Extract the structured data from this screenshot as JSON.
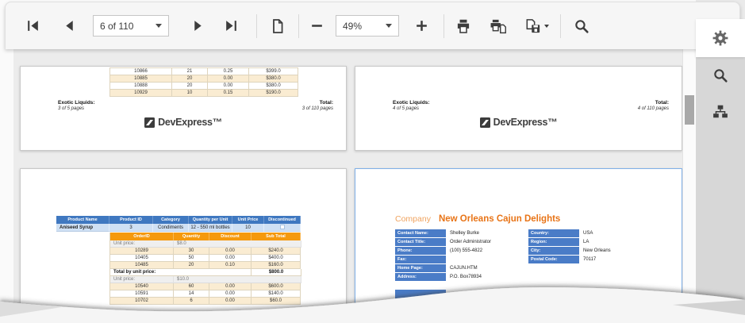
{
  "toolbar": {
    "page_value": "6 of 110",
    "zoom_value": "49%"
  },
  "icons": {
    "first_page": "|◀",
    "previous_page": "◀",
    "next_page": "▶",
    "last_page": "▶|",
    "single_page_view": "🗋",
    "zoom_out": "−",
    "zoom_in": "+",
    "print": "🖶",
    "print_page": "🖶🗋",
    "export": "💾▾",
    "search": "🔍",
    "collapse_panel": "‹",
    "settings_gear": "⚙",
    "search_panel": "🔍",
    "document_map": "🗺"
  },
  "colors": {
    "header_blue": "#3f78c0",
    "row_blue": "#cfe0f4",
    "accent_orange": "#f5990d",
    "row_tan": "#faecd2",
    "company_orange": "#e87417",
    "selected_page_border": "#7fb0e8"
  },
  "document": {
    "logo_text": "DevExpress™"
  },
  "pages": {
    "top_left": {
      "orders": [
        {
          "id": "10866",
          "qty": "21",
          "discount": "0.25",
          "subtotal": "$399.0"
        },
        {
          "id": "10885",
          "qty": "20",
          "discount": "0.00",
          "subtotal": "$380.0"
        },
        {
          "id": "10888",
          "qty": "20",
          "discount": "0.00",
          "subtotal": "$380.0"
        },
        {
          "id": "10929",
          "qty": "10",
          "discount": "0.15",
          "subtotal": "$190.0"
        }
      ],
      "footer": {
        "group": "Exotic Liquids:",
        "group_pages": "3 of 5 pages",
        "total_label": "Total:",
        "total_pages": "3 of 110 pages"
      }
    },
    "top_right": {
      "footer": {
        "group": "Exotic Liquids:",
        "group_pages": "4 of 5 pages",
        "total_label": "Total:",
        "total_pages": "4 of 110 pages"
      }
    },
    "bottom_left": {
      "product_header": [
        "Product Name",
        "Product ID",
        "Category",
        "Quantity per Unit",
        "Unit Price",
        "Discontinued"
      ],
      "product": {
        "name": "Aniseed Syrup",
        "id": "3",
        "category": "Condiments",
        "qty_per_unit": "12 - 550 ml bottles",
        "unit_price": "10"
      },
      "order_header": [
        "OrderID",
        "Quantity",
        "Discount",
        "Sub Total"
      ],
      "sections": [
        {
          "unit_price_label": "Unit price:",
          "unit_price": "$8.0",
          "rows": [
            {
              "id": "10289",
              "qty": "30",
              "discount": "0.00",
              "subtotal": "$240.0"
            },
            {
              "id": "10405",
              "qty": "50",
              "discount": "0.00",
              "subtotal": "$400.0"
            },
            {
              "id": "10485",
              "qty": "20",
              "discount": "0.10",
              "subtotal": "$160.0"
            }
          ],
          "total_label": "Total by unit price:",
          "total": "$800.0"
        },
        {
          "unit_price_label": "Unit price:",
          "unit_price": "$10.0",
          "rows": [
            {
              "id": "10540",
              "qty": "60",
              "discount": "0.00",
              "subtotal": "$600.0"
            },
            {
              "id": "10591",
              "qty": "14",
              "discount": "0.00",
              "subtotal": "$140.0"
            },
            {
              "id": "10702",
              "qty": "6",
              "discount": "0.00",
              "subtotal": "$60.0"
            }
          ]
        }
      ]
    },
    "bottom_right": {
      "company_label": "Company",
      "company_name": "New Orleans Cajun Delights",
      "left_fields": [
        {
          "label": "Contact Name:",
          "value": "Shelley Burke"
        },
        {
          "label": "Contact Title:",
          "value": "Order Administrator"
        },
        {
          "label": "Phone:",
          "value": "(100) 555-4822"
        },
        {
          "label": "Fax:",
          "value": ""
        },
        {
          "label": "Home Page:",
          "value": "CAJUN.HTM"
        },
        {
          "label": "Address:",
          "value": "P.O. Box78934"
        }
      ],
      "right_fields": [
        {
          "label": "Country:",
          "value": "USA"
        },
        {
          "label": "Region:",
          "value": "LA"
        },
        {
          "label": "City:",
          "value": "New Orleans"
        },
        {
          "label": "Postal Code:",
          "value": "70117"
        }
      ]
    }
  }
}
